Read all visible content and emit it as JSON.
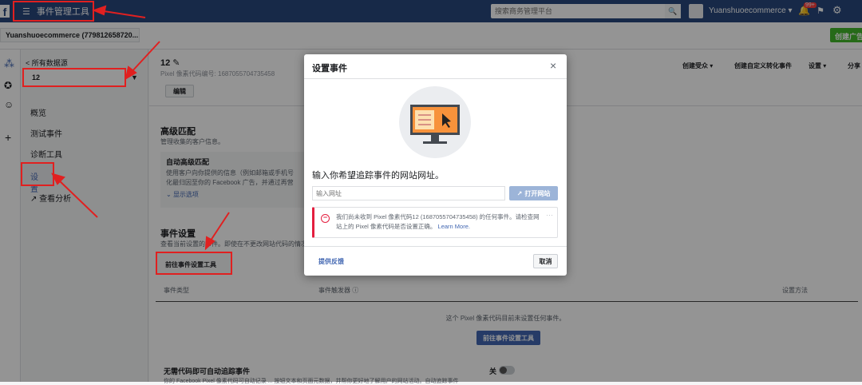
{
  "topbar": {
    "logo": "f",
    "title": "事件管理工具",
    "search_placeholder": "搜索商务管理平台",
    "account_name": "Yuanshuoecommerce",
    "notif_badge": "99+"
  },
  "bar2": {
    "account_selector": "Yuanshuoecommerce (779812658720...",
    "create_ad": "创建广告"
  },
  "sidebar": {
    "back_link": "< 所有数据源",
    "pixel_select": "12",
    "items": [
      "概览",
      "测试事件",
      "诊断工具",
      "设置",
      "查看分析"
    ]
  },
  "main": {
    "pixel_name": "12",
    "pixel_id": "Pixel 像素代码编号: 1687055704735458",
    "edit": "编辑",
    "actions": [
      "创建受众",
      "创建自定义转化事件",
      "设置",
      "分享"
    ],
    "advanced_title": "高级匹配",
    "advanced_desc": "管理收集的客户信息。",
    "auto_title": "自动高级匹配",
    "auto_desc1": "使用客户向你提供的信息（例如邮箱或手机号",
    "auto_desc2": "化最归因至你的 Facebook 广告，并通过再营",
    "show_options": "显示选项",
    "events_title": "事件设置",
    "events_desc": "查看当前设置的事件。即使在不更改网站代码的情况",
    "open_tool": "前往事件设置工具",
    "table_headers": [
      "事件类型",
      "事件触发器",
      "设置方法"
    ],
    "empty_text": "这个 Pixel 像素代码目前未设置任何事件。",
    "empty_button": "前往事件设置工具",
    "auto_track_title": "无需代码即可自动追踪事件",
    "auto_track_toggle": "关",
    "auto_track_desc": "你的 Facebook Pixel 像素代码可自动记录 ... 按钮文本和页面元数据，并帮你更好地了解用户的网站活动。自动追踪事件"
  },
  "modal": {
    "title": "设置事件",
    "prompt": "输入你希望追踪事件的网站网址。",
    "url_placeholder": "输入网址",
    "open_site": "打开网站",
    "error_text": "我们尚未收到 Pixel 像素代码12 (1687055704735458) 的任何事件。请检查网站上的 Pixel 像素代码是否设置正确。",
    "learn_more": "Learn More.",
    "feedback": "提供反馈",
    "cancel": "取消"
  },
  "colors": {
    "accent": "#4267b2",
    "green": "#42b72a",
    "annotation": "#e02020",
    "error": "#e41e3f"
  }
}
